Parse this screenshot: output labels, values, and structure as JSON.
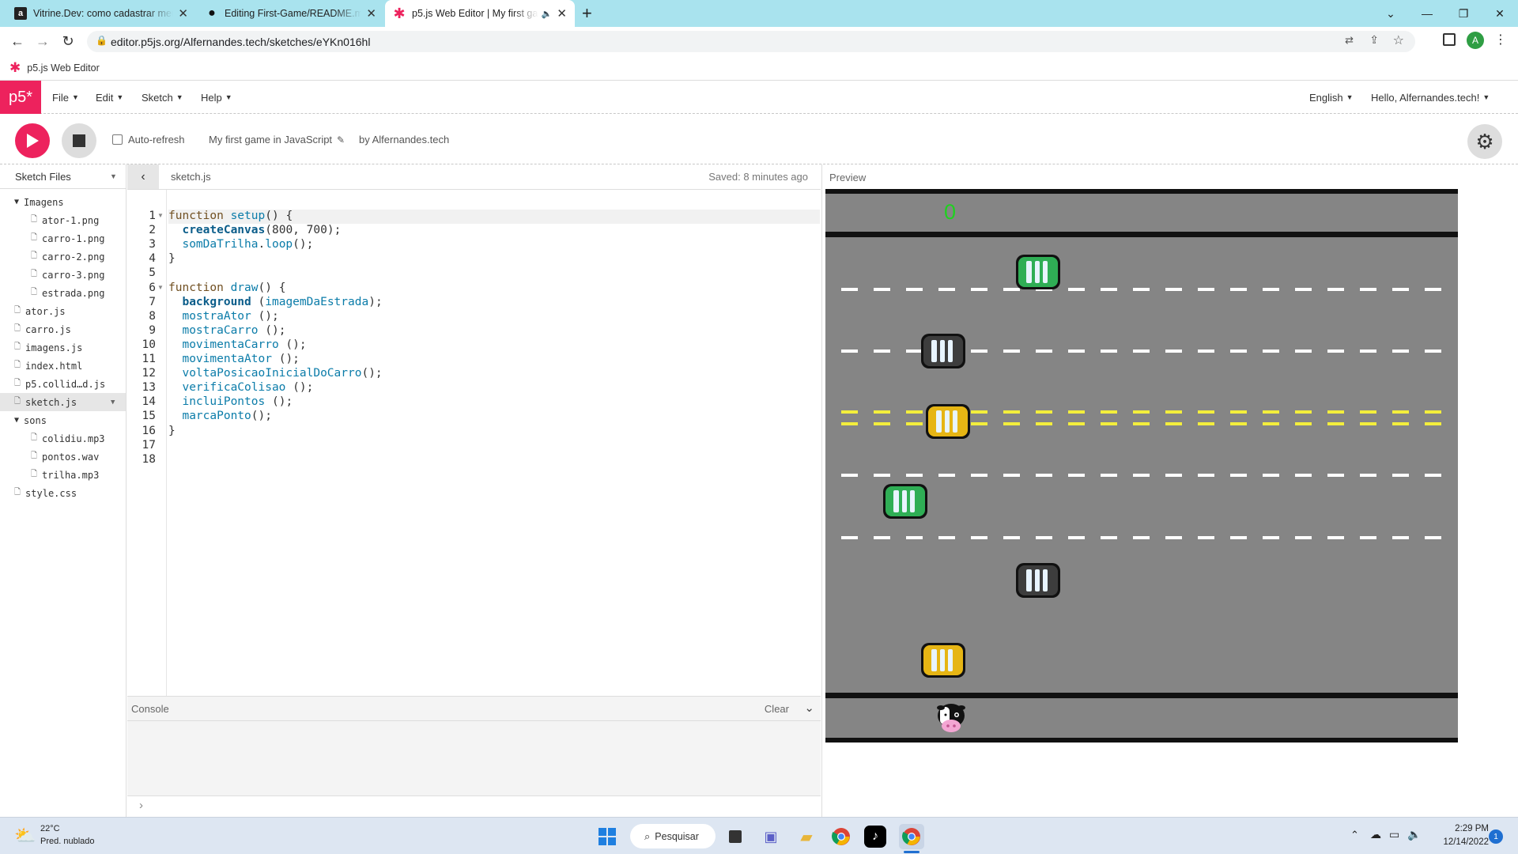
{
  "browser": {
    "tabs": [
      {
        "title": "Vitrine.Dev: como cadastrar meu",
        "icon": "vitrine-dev-icon",
        "icon_char": "a"
      },
      {
        "title": "Editing First-Game/README.md",
        "icon": "github-icon",
        "icon_char": "●"
      },
      {
        "title": "p5.js Web Editor | My first ga",
        "icon": "p5-icon",
        "icon_char": "✱",
        "audio_icon": "🔈"
      }
    ],
    "url": "editor.p5js.org/Alfernandes.tech/sketches/eYKn016hl",
    "bookmark": "p5.js Web Editor"
  },
  "p5": {
    "logo": "p5*",
    "menus": [
      "File",
      "Edit",
      "Sketch",
      "Help"
    ],
    "language": "English",
    "greeting": "Hello, Alfernandes.tech!",
    "auto_refresh": "Auto-refresh",
    "sketch_name": "My first game in JavaScript",
    "author": "by Alfernandes.tech",
    "sidebar_title": "Sketch Files",
    "files": [
      {
        "name": "Imagens",
        "type": "folder",
        "depth": 0
      },
      {
        "name": "ator-1.png",
        "type": "file",
        "depth": 1
      },
      {
        "name": "carro-1.png",
        "type": "file",
        "depth": 1
      },
      {
        "name": "carro-2.png",
        "type": "file",
        "depth": 1
      },
      {
        "name": "carro-3.png",
        "type": "file",
        "depth": 1
      },
      {
        "name": "estrada.png",
        "type": "file",
        "depth": 1
      },
      {
        "name": "ator.js",
        "type": "file",
        "depth": 0
      },
      {
        "name": "carro.js",
        "type": "file",
        "depth": 0
      },
      {
        "name": "imagens.js",
        "type": "file",
        "depth": 0
      },
      {
        "name": "index.html",
        "type": "file",
        "depth": 0
      },
      {
        "name": "p5.collid…d.js",
        "type": "file",
        "depth": 0
      },
      {
        "name": "sketch.js",
        "type": "file",
        "depth": 0,
        "selected": true
      },
      {
        "name": "sons",
        "type": "folder",
        "depth": 0
      },
      {
        "name": "colidiu.mp3",
        "type": "file",
        "depth": 1
      },
      {
        "name": "pontos.wav",
        "type": "file",
        "depth": 1
      },
      {
        "name": "trilha.mp3",
        "type": "file",
        "depth": 1
      },
      {
        "name": "style.css",
        "type": "file",
        "depth": 0
      }
    ],
    "editor_tab": "sketch.js",
    "saved": "Saved: 8 minutes ago",
    "preview_label": "Preview",
    "console_label": "Console",
    "console_clear": "Clear",
    "console_prompt": "›",
    "line_numbers": [
      "1",
      "2",
      "3",
      "4",
      "5",
      "6",
      "7",
      "8",
      "9",
      "10",
      "11",
      "12",
      "13",
      "14",
      "15",
      "16",
      "17",
      "18"
    ],
    "code_lines": [
      "function setup() {",
      "  createCanvas(800, 700);",
      "  somDaTrilha.loop();",
      "}",
      "",
      "function draw() {",
      "  background (imagemDaEstrada);",
      "  mostraAtor ();",
      "  mostraCarro ();",
      "  movimentaCarro ();",
      "  movimentaAtor ();",
      "  voltaPosicaoInicialDoCarro();",
      "  verificaColisao ();",
      "  incluiPontos ();",
      "  marcaPonto();",
      "}",
      "",
      ""
    ]
  },
  "game": {
    "score": "0",
    "cars": [
      {
        "color": "#2fae55",
        "lane": 1
      },
      {
        "color": "#3d3d3d",
        "lane": 2
      },
      {
        "color": "#e6b514",
        "lane": 3
      },
      {
        "color": "#2fae55",
        "lane": 4
      },
      {
        "color": "#3d3d3d",
        "lane": 5
      },
      {
        "color": "#e6b514",
        "lane": 6
      }
    ]
  },
  "taskbar": {
    "temperature": "22°C",
    "weather": "Pred. nublado",
    "search": "Pesquisar",
    "time": "2:29 PM",
    "date": "12/14/2022",
    "notifications": "1"
  },
  "colors": {
    "p5_pink": "#ed225d",
    "tab_strip": "#a9e3ee",
    "road": "#858585",
    "score_green": "#1fd11f"
  }
}
